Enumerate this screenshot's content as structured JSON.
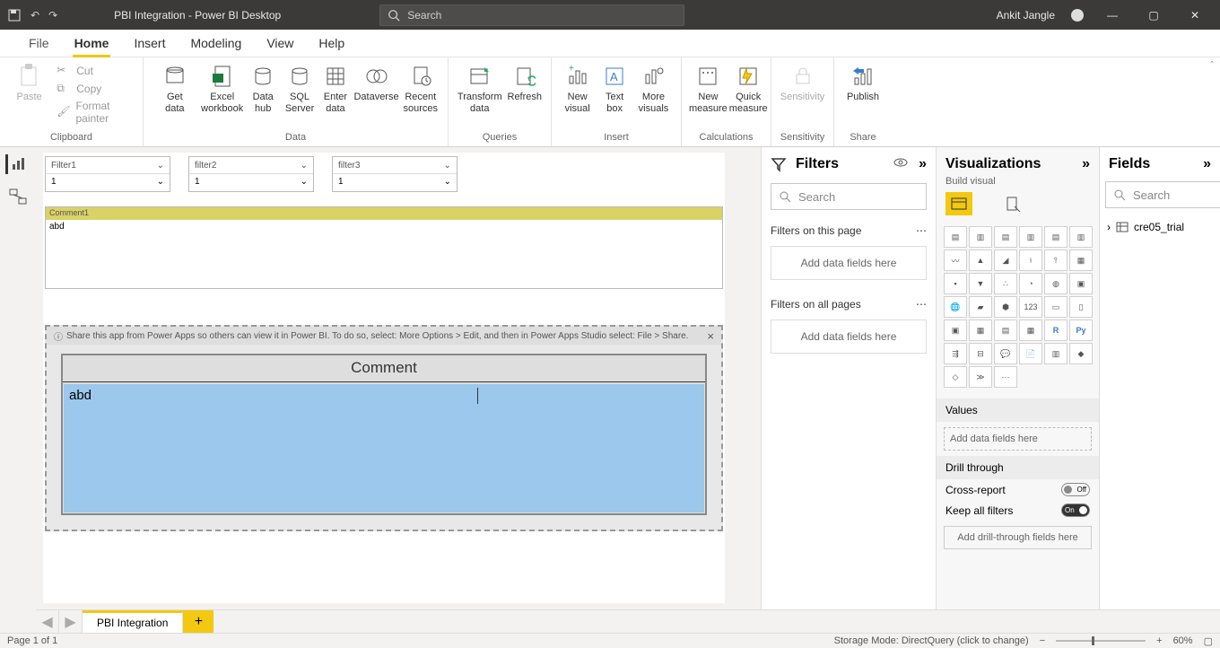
{
  "titlebar": {
    "title": "PBI Integration - Power BI Desktop",
    "search_placeholder": "Search",
    "user": "Ankit Jangle"
  },
  "menu": {
    "file": "File",
    "home": "Home",
    "insert": "Insert",
    "modeling": "Modeling",
    "view": "View",
    "help": "Help"
  },
  "ribbon": {
    "clipboard": {
      "label": "Clipboard",
      "paste": "Paste",
      "cut": "Cut",
      "copy": "Copy",
      "format": "Format painter"
    },
    "data": {
      "label": "Data",
      "get": "Get\ndata",
      "excel": "Excel\nworkbook",
      "hub": "Data\nhub",
      "sql": "SQL\nServer",
      "enter": "Enter\ndata",
      "dv": "Dataverse",
      "recent": "Recent\nsources"
    },
    "queries": {
      "label": "Queries",
      "transform": "Transform\ndata",
      "refresh": "Refresh"
    },
    "insert": {
      "label": "Insert",
      "visual": "New\nvisual",
      "text": "Text\nbox",
      "more": "More\nvisuals"
    },
    "calc": {
      "label": "Calculations",
      "measure": "New\nmeasure",
      "quick": "Quick\nmeasure"
    },
    "sens": {
      "label": "Sensitivity",
      "btn": "Sensitivity"
    },
    "share": {
      "label": "Share",
      "publish": "Publish"
    }
  },
  "canvas": {
    "slicers": [
      {
        "name": "Filter1",
        "value": "1"
      },
      {
        "name": "filter2",
        "value": "1"
      },
      {
        "name": "filter3",
        "value": "1"
      }
    ],
    "comment_hdr": "Comment1",
    "comment_body": "abd",
    "tip": "Share this app from Power Apps so others can view it in Power BI. To do so, select: More Options > Edit, and then in Power Apps Studio select: File > Share.",
    "comment_title": "Comment",
    "comment_text": "abd"
  },
  "filters": {
    "title": "Filters",
    "search": "Search",
    "page": "Filters on this page",
    "all": "Filters on all pages",
    "add": "Add data fields here"
  },
  "viz": {
    "title": "Visualizations",
    "sub": "Build visual",
    "values": "Values",
    "add": "Add data fields here",
    "drill": "Drill through",
    "cross": "Cross-report",
    "keep": "Keep all filters",
    "add2": "Add drill-through fields here",
    "off": "Off",
    "on": "On"
  },
  "fields": {
    "title": "Fields",
    "search": "Search",
    "table": "cre05_trial"
  },
  "pagetab": "PBI Integration",
  "status": {
    "page": "Page 1 of 1",
    "mode": "Storage Mode: DirectQuery (click to change)",
    "zoom": "60%"
  }
}
